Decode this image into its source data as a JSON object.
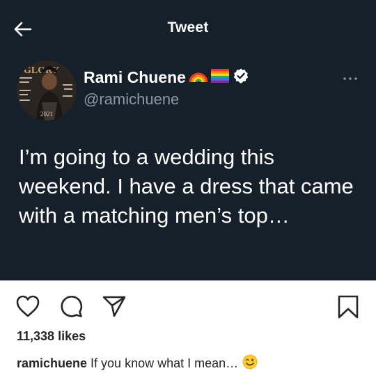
{
  "header": {
    "title": "Tweet"
  },
  "author": {
    "name": "Rami Chuene",
    "handle": "@ramichuene"
  },
  "tweet": {
    "text": "I’m going to a wedding this weekend. I have a dress that came with a matching men’s top…"
  },
  "post": {
    "likes": "11,338 likes",
    "caption_user": "ramichuene",
    "caption_text": "If you know what I mean…"
  },
  "colors": {
    "tweet_bg": "#15202b",
    "secondary_text": "#8b98a5",
    "verified": "#ffffff"
  },
  "icons": [
    "back-arrow-icon",
    "more-icon",
    "verified-badge-icon",
    "heart-icon",
    "comment-icon",
    "share-icon",
    "bookmark-icon",
    "wink-emoji-icon"
  ]
}
